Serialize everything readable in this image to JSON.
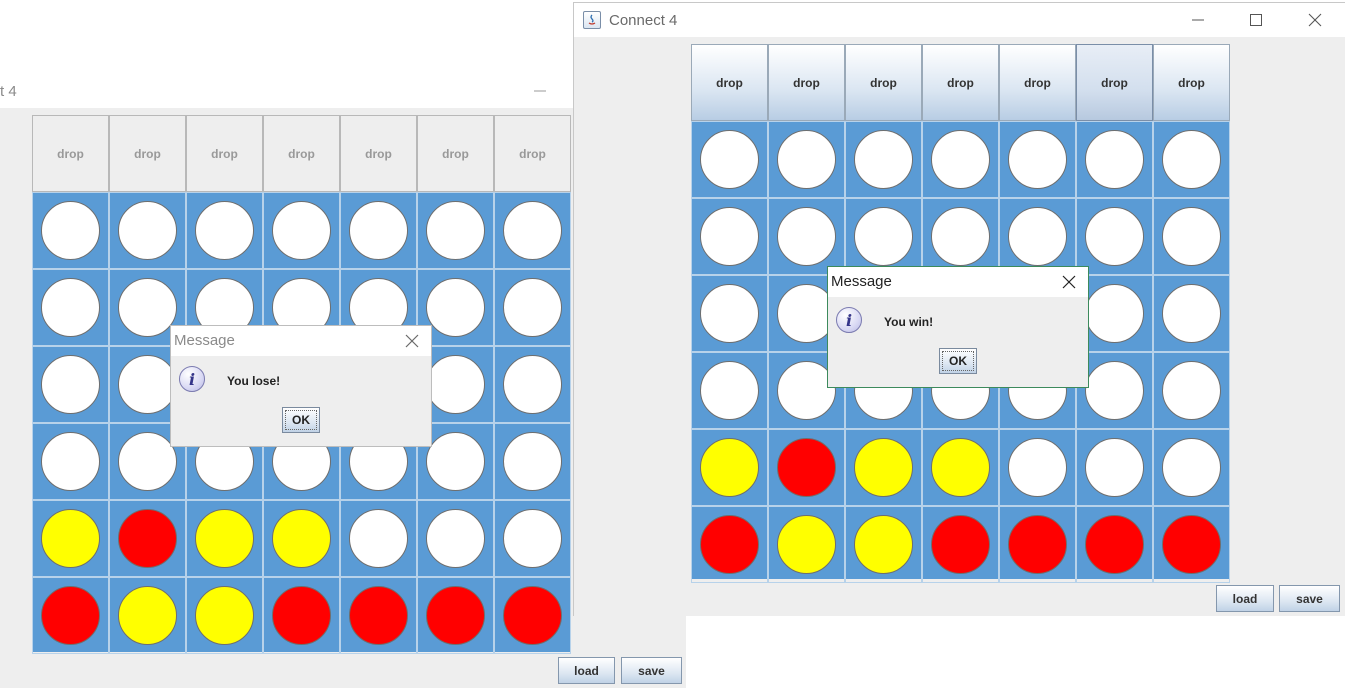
{
  "colors": {
    "board": "#5a9bd5",
    "empty": "#ffffff",
    "red": "#ff0000",
    "yellow": "#ffff00"
  },
  "left_window": {
    "title": "t 4",
    "drop_buttons": [
      "drop",
      "drop",
      "drop",
      "drop",
      "drop",
      "drop",
      "drop"
    ],
    "drop_buttons_enabled": false,
    "board": [
      [
        "W",
        "W",
        "W",
        "W",
        "W",
        "W",
        "W"
      ],
      [
        "W",
        "W",
        "W",
        "W",
        "W",
        "W",
        "W"
      ],
      [
        "W",
        "W",
        "W",
        "W",
        "W",
        "W",
        "W"
      ],
      [
        "W",
        "W",
        "W",
        "W",
        "W",
        "W",
        "W"
      ],
      [
        "Y",
        "R",
        "Y",
        "Y",
        "W",
        "W",
        "W"
      ],
      [
        "R",
        "Y",
        "Y",
        "R",
        "R",
        "R",
        "R"
      ]
    ],
    "load_label": "load",
    "save_label": "save",
    "dialog": {
      "title": "Message",
      "icon": "info-icon",
      "message": "You lose!",
      "ok_label": "OK"
    }
  },
  "right_window": {
    "title": "Connect 4",
    "drop_buttons": [
      "drop",
      "drop",
      "drop",
      "drop",
      "drop",
      "drop",
      "drop"
    ],
    "drop_buttons_enabled": true,
    "board": [
      [
        "W",
        "W",
        "W",
        "W",
        "W",
        "W",
        "W"
      ],
      [
        "W",
        "W",
        "W",
        "W",
        "W",
        "W",
        "W"
      ],
      [
        "W",
        "W",
        "W",
        "W",
        "W",
        "W",
        "W"
      ],
      [
        "W",
        "W",
        "W",
        "W",
        "W",
        "W",
        "W"
      ],
      [
        "Y",
        "R",
        "Y",
        "Y",
        "W",
        "W",
        "W"
      ],
      [
        "R",
        "Y",
        "Y",
        "R",
        "R",
        "R",
        "R"
      ]
    ],
    "load_label": "load",
    "save_label": "save",
    "dialog": {
      "title": "Message",
      "icon": "info-icon",
      "message": "You win!",
      "ok_label": "OK"
    }
  }
}
